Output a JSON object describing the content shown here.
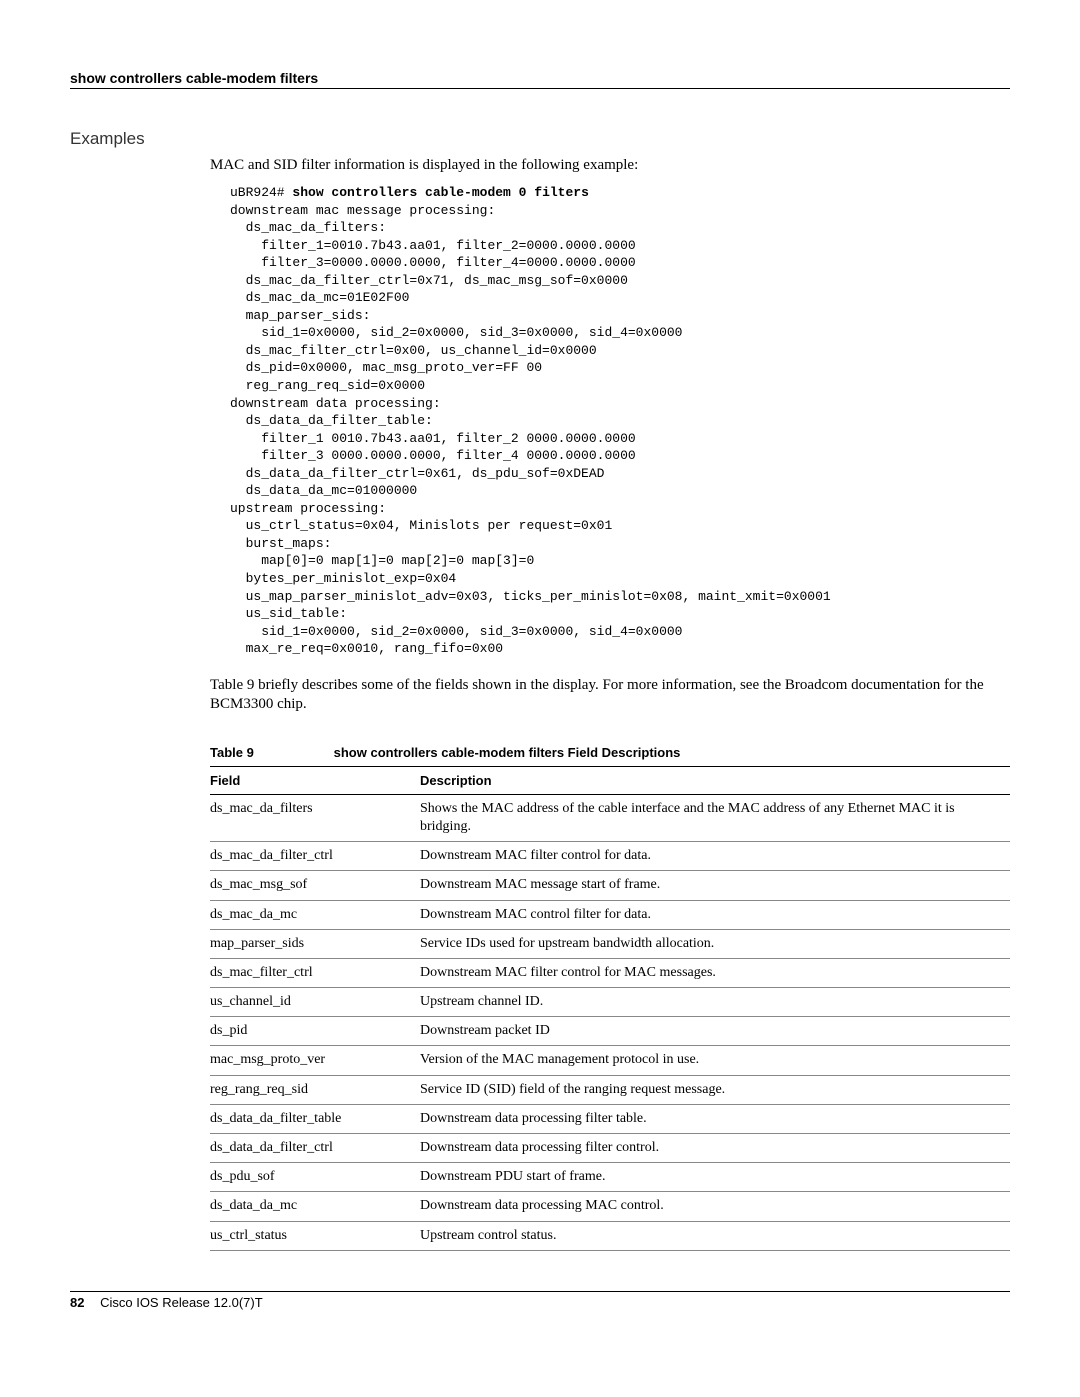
{
  "header": {
    "title": "show controllers cable-modem filters"
  },
  "section_label": "Examples",
  "intro": "MAC and SID filter information is displayed in the following example:",
  "code_prompt": "uBR924# ",
  "code_cmd": "show controllers cable-modem 0 filters",
  "code_body": "downstream mac message processing:\n  ds_mac_da_filters:\n    filter_1=0010.7b43.aa01, filter_2=0000.0000.0000\n    filter_3=0000.0000.0000, filter_4=0000.0000.0000\n  ds_mac_da_filter_ctrl=0x71, ds_mac_msg_sof=0x0000\n  ds_mac_da_mc=01E02F00\n  map_parser_sids:\n    sid_1=0x0000, sid_2=0x0000, sid_3=0x0000, sid_4=0x0000\n  ds_mac_filter_ctrl=0x00, us_channel_id=0x0000\n  ds_pid=0x0000, mac_msg_proto_ver=FF 00\n  reg_rang_req_sid=0x0000\ndownstream data processing:\n  ds_data_da_filter_table:\n    filter_1 0010.7b43.aa01, filter_2 0000.0000.0000\n    filter_3 0000.0000.0000, filter_4 0000.0000.0000\n  ds_data_da_filter_ctrl=0x61, ds_pdu_sof=0xDEAD\n  ds_data_da_mc=01000000\nupstream processing:\n  us_ctrl_status=0x04, Minislots per request=0x01\n  burst_maps:\n    map[0]=0 map[1]=0 map[2]=0 map[3]=0\n  bytes_per_minislot_exp=0x04\n  us_map_parser_minislot_adv=0x03, ticks_per_minislot=0x08, maint_xmit=0x0001\n  us_sid_table:\n    sid_1=0x0000, sid_2=0x0000, sid_3=0x0000, sid_4=0x0000\n  max_re_req=0x0010, rang_fifo=0x00",
  "post_code_para": "Table 9 briefly describes some of the fields shown in the display. For more information, see the Broadcom documentation for the BCM3300 chip.",
  "table": {
    "number_label": "Table 9",
    "title": "show controllers cable-modem filters Field Descriptions",
    "col_field": "Field",
    "col_desc": "Description",
    "rows": [
      {
        "f": "ds_mac_da_filters",
        "d": "Shows the MAC address of the cable interface and the MAC address of any Ethernet MAC it is bridging."
      },
      {
        "f": "ds_mac_da_filter_ctrl",
        "d": "Downstream MAC filter control for data."
      },
      {
        "f": "ds_mac_msg_sof",
        "d": "Downstream MAC message start of frame."
      },
      {
        "f": "ds_mac_da_mc",
        "d": "Downstream MAC control filter for data."
      },
      {
        "f": "map_parser_sids",
        "d": "Service IDs used for upstream bandwidth allocation."
      },
      {
        "f": "ds_mac_filter_ctrl",
        "d": "Downstream MAC filter control for MAC messages."
      },
      {
        "f": "us_channel_id",
        "d": "Upstream channel ID."
      },
      {
        "f": "ds_pid",
        "d": "Downstream packet ID"
      },
      {
        "f": "mac_msg_proto_ver",
        "d": "Version of the MAC management protocol in use."
      },
      {
        "f": "reg_rang_req_sid",
        "d": "Service ID (SID) field of the ranging request message."
      },
      {
        "f": "ds_data_da_filter_table",
        "d": "Downstream data processing filter table."
      },
      {
        "f": "ds_data_da_filter_ctrl",
        "d": "Downstream data processing filter control."
      },
      {
        "f": "ds_pdu_sof",
        "d": "Downstream PDU start of frame."
      },
      {
        "f": "ds_data_da_mc",
        "d": "Downstream data processing MAC control."
      },
      {
        "f": "us_ctrl_status",
        "d": "Upstream control status."
      }
    ]
  },
  "footer": {
    "page_number": "82",
    "doc_title": "Cisco IOS Release 12.0(7)T"
  }
}
